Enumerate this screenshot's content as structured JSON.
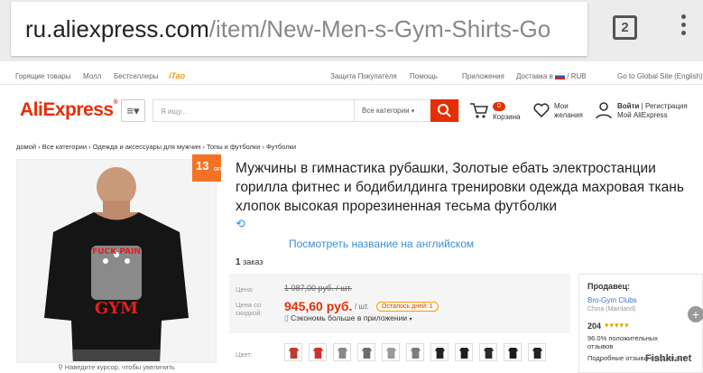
{
  "browser": {
    "url_domain": "ru.aliexpress.com",
    "url_path": "/item/New-Men-s-Gym-Shirts-Go",
    "tab_count": "2"
  },
  "topnav": {
    "hot": "Горящие товары",
    "mall": "Молл",
    "bestsellers": "Бестселлеры",
    "tao": "iTao",
    "buyer_protection": "Защита Покупателя",
    "help": "Помощь",
    "apps": "Приложения",
    "delivery": "Доставка в",
    "currency": "/ RUB",
    "global": "Go to Global Site (English)"
  },
  "header": {
    "logo": "AliExpress",
    "search_placeholder": "Я ищу...",
    "category": "Все категории",
    "cart_count": "0",
    "cart_label": "Корзина",
    "wishlist_label": "Мои желания",
    "signin": "Войти",
    "register": "Регистрация",
    "my_account": "Мой AliExpress"
  },
  "breadcrumb": "домой › Все категории › Одежда и аксессуары для мужчин › Топы и футболки › Футболки",
  "product": {
    "discount": "13",
    "discount_suffix": "OFF",
    "title": "Мужчины в гимнастика рубашки, Золотые ебать электростанции гориллa фитнес и бодибилдинга тренировки одежда махровая ткань хлопок высокая прорезиненная тесьма футболки",
    "see_english": "Посмотреть название на английском",
    "orders_count": "1",
    "orders_label": "заказ",
    "price_label": "Цена:",
    "old_price": "1 087,00 руб. / шт.",
    "discount_price_label": "Цена со скидкой:",
    "price": "945,60 руб.",
    "unit": "/ шт.",
    "stock": "Осталось дней: 1",
    "app_promo": "Сэкономь больше в приложении",
    "color_label": "Цвет:",
    "zoom_hint": "Наведите курсор, чтобы увеличить",
    "shirt_print_1": "FUCK PAIN",
    "shirt_print_2": "GYM",
    "swatch_colors": [
      "#c0392b",
      "#d0312d",
      "#888888",
      "#6e6e6e",
      "#9a9a9a",
      "#7d7d7d",
      "#222222",
      "#1e1e1e",
      "#2a2a2a",
      "#1a1a1a",
      "#222222"
    ]
  },
  "seller": {
    "heading": "Продавец:",
    "name": "Bro-Gym Clubs",
    "location": "China (Mainland)",
    "score": "204",
    "positive": "96.0% положительных отзывов",
    "more": "Подробные отзывы продавца"
  },
  "watermark": "Fishki.net",
  "colors": {
    "brand": "#e62e04",
    "link": "#3b8fd8",
    "badge": "#f57224"
  }
}
